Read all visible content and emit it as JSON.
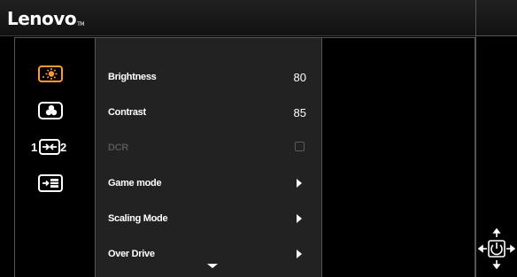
{
  "brand": {
    "name": "Lenovo",
    "tm": "TM"
  },
  "categories": [
    {
      "icon": "brightness-icon",
      "selected": true
    },
    {
      "icon": "color-icon",
      "selected": false
    },
    {
      "icon": "input-source-icon",
      "selected": false
    },
    {
      "icon": "menu-settings-icon",
      "selected": false
    }
  ],
  "menu": {
    "items": [
      {
        "label": "Brightness",
        "value": "80"
      },
      {
        "label": "Contrast",
        "value": "85"
      },
      {
        "label": "DCR",
        "checked": false,
        "disabled": true
      },
      {
        "label": "Game mode"
      },
      {
        "label": "Scaling Mode"
      },
      {
        "label": "Over Drive"
      }
    ]
  },
  "colors": {
    "accent": "#ff9a2e",
    "menu_bg": "#222222",
    "border": "#555555"
  },
  "nav": {
    "icon": "joystick-navigation-icon"
  }
}
